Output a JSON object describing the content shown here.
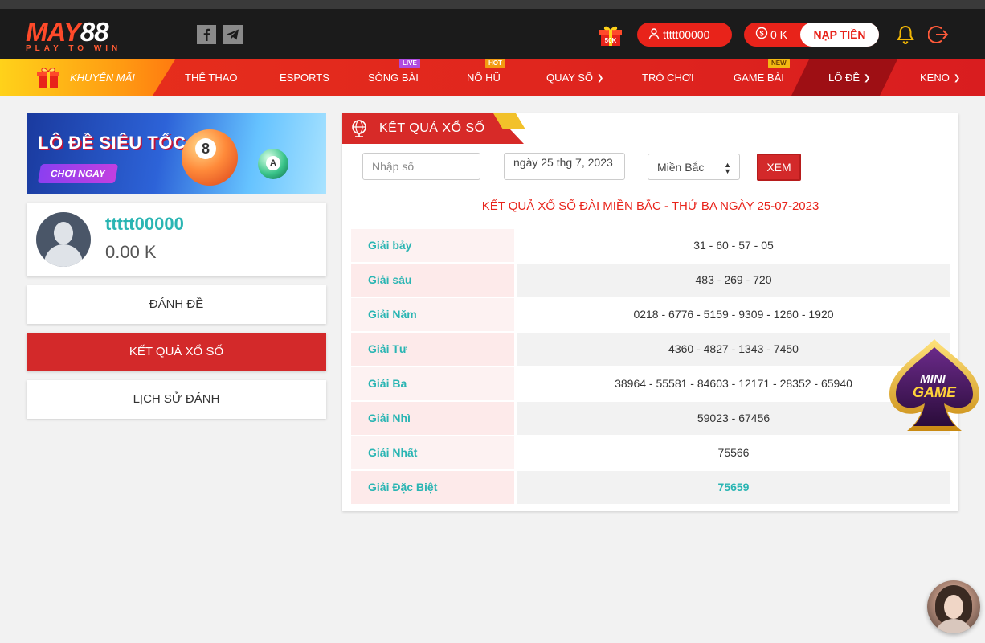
{
  "header": {
    "logo_main_a": "MAY",
    "logo_main_b": "88",
    "logo_sub": "PLAY TO WIN",
    "username": "ttttt00000",
    "balance": "0 K",
    "deposit_label": "NẠP TIỀN",
    "gift_badge": "50K",
    "accent_color": "#e8231a"
  },
  "nav": {
    "promo": "KHUYẾN MÃI",
    "items": [
      {
        "label": "THỂ THAO",
        "badge": ""
      },
      {
        "label": "ESPORTS",
        "badge": ""
      },
      {
        "label": "SÒNG BÀI",
        "badge": "LIVE"
      },
      {
        "label": "NỔ HŨ",
        "badge": "HOT"
      },
      {
        "label": "QUAY SỐ",
        "badge": ""
      },
      {
        "label": "TRÒ CHƠI",
        "badge": ""
      },
      {
        "label": "GAME BÀI",
        "badge": "NEW"
      },
      {
        "label": "LÔ ĐỀ",
        "badge": ""
      },
      {
        "label": "KENO",
        "badge": ""
      }
    ]
  },
  "sidebar": {
    "banner_title": "LÔ ĐỀ SIÊU TỐC",
    "banner_button": "CHƠI NGAY",
    "banner_ball": "8",
    "banner_ball2": "A",
    "profile_name": "ttttt00000",
    "profile_balance": "0.00 K",
    "menu": [
      "ĐÁNH ĐỀ",
      "KẾT QUẢ XỔ SỐ",
      "LỊCH SỬ ĐÁNH"
    ]
  },
  "results": {
    "card_title": "KẾT QUẢ XỔ SỐ",
    "search_placeholder": "Nhập số",
    "date_value": "ngày 25 thg 7, 2023",
    "region_value": "Miền Bắc",
    "view_button": "XEM",
    "heading": "KẾT QUẢ XỔ SỐ ĐÀI MIỀN BẮC - THỨ BA NGÀY 25-07-2023",
    "rows": [
      {
        "label": "Giải bảy",
        "value": "31 - 60 - 57 - 05"
      },
      {
        "label": "Giải sáu",
        "value": "483 - 269 - 720"
      },
      {
        "label": "Giải Năm",
        "value": "0218 - 6776 - 5159 - 9309 - 1260 - 1920"
      },
      {
        "label": "Giải Tư",
        "value": "4360 - 4827 - 1343 - 7450"
      },
      {
        "label": "Giải Ba",
        "value": "38964 - 55581 - 84603 - 12171 - 28352 - 65940"
      },
      {
        "label": "Giải Nhì",
        "value": "59023 - 67456"
      },
      {
        "label": "Giải Nhất",
        "value": "75566"
      },
      {
        "label": "Giải Đặc Biệt",
        "value": "75659"
      }
    ]
  },
  "minigame_label_a": "MINI",
  "minigame_label_b": "GAME"
}
